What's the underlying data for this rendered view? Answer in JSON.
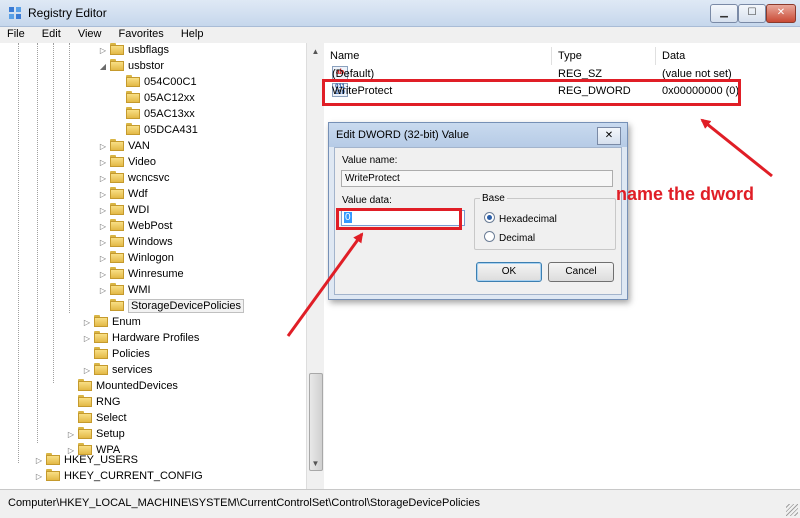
{
  "window": {
    "title": "Registry Editor",
    "minimize": "▁",
    "maximize": "☐",
    "close": "✕"
  },
  "menu": [
    "File",
    "Edit",
    "View",
    "Favorites",
    "Help"
  ],
  "tree": {
    "items": [
      {
        "label": "usbflags",
        "expander": "▷"
      },
      {
        "label": "usbstor",
        "expander": "◢"
      },
      {
        "label": "054C00C1",
        "expander": ""
      },
      {
        "label": "05AC12xx",
        "expander": ""
      },
      {
        "label": "05AC13xx",
        "expander": ""
      },
      {
        "label": "05DCA431",
        "expander": ""
      },
      {
        "label": "VAN",
        "expander": "▷"
      },
      {
        "label": "Video",
        "expander": "▷"
      },
      {
        "label": "wcncsvc",
        "expander": "▷"
      },
      {
        "label": "Wdf",
        "expander": "▷"
      },
      {
        "label": "WDI",
        "expander": "▷"
      },
      {
        "label": "WebPost",
        "expander": "▷"
      },
      {
        "label": "Windows",
        "expander": "▷"
      },
      {
        "label": "Winlogon",
        "expander": "▷"
      },
      {
        "label": "Winresume",
        "expander": "▷"
      },
      {
        "label": "WMI",
        "expander": "▷"
      },
      {
        "label": "StorageDevicePolicies",
        "expander": ""
      },
      {
        "label": "Enum",
        "expander": "▷"
      },
      {
        "label": "Hardware Profiles",
        "expander": "▷"
      },
      {
        "label": "Policies",
        "expander": ""
      },
      {
        "label": "services",
        "expander": "▷"
      },
      {
        "label": "MountedDevices",
        "expander": ""
      },
      {
        "label": "RNG",
        "expander": ""
      },
      {
        "label": "Select",
        "expander": ""
      },
      {
        "label": "Setup",
        "expander": "▷"
      },
      {
        "label": "WPA",
        "expander": "▷"
      },
      {
        "label": "HKEY_USERS",
        "expander": "▷"
      },
      {
        "label": "HKEY_CURRENT_CONFIG",
        "expander": "▷"
      }
    ],
    "selected": "StorageDevicePolicies"
  },
  "values": {
    "columns": [
      "Name",
      "Type",
      "Data"
    ],
    "rows": [
      {
        "icon": "ab",
        "name": "(Default)",
        "type": "REG_SZ",
        "data": "(value not set)"
      },
      {
        "icon": "011 110",
        "name": "WriteProtect",
        "type": "REG_DWORD",
        "data": "0x00000000 (0)"
      }
    ]
  },
  "dialog": {
    "title": "Edit DWORD (32-bit) Value",
    "close": "✕",
    "value_name_label": "Value name:",
    "value_name": "WriteProtect",
    "value_data_label": "Value data:",
    "value_data": "0",
    "base_label": "Base",
    "hex_label": "Hexadecimal",
    "dec_label": "Decimal",
    "ok": "OK",
    "cancel": "Cancel"
  },
  "annotation": {
    "text": "name the dword",
    "color": "#e01e26"
  },
  "status": {
    "path": "Computer\\HKEY_LOCAL_MACHINE\\SYSTEM\\CurrentControlSet\\Control\\StorageDevicePolicies"
  },
  "scroll": {
    "left_arrow": "◀",
    "right_arrow": "▶",
    "up_arrow": "▲",
    "down_arrow": "▼"
  }
}
